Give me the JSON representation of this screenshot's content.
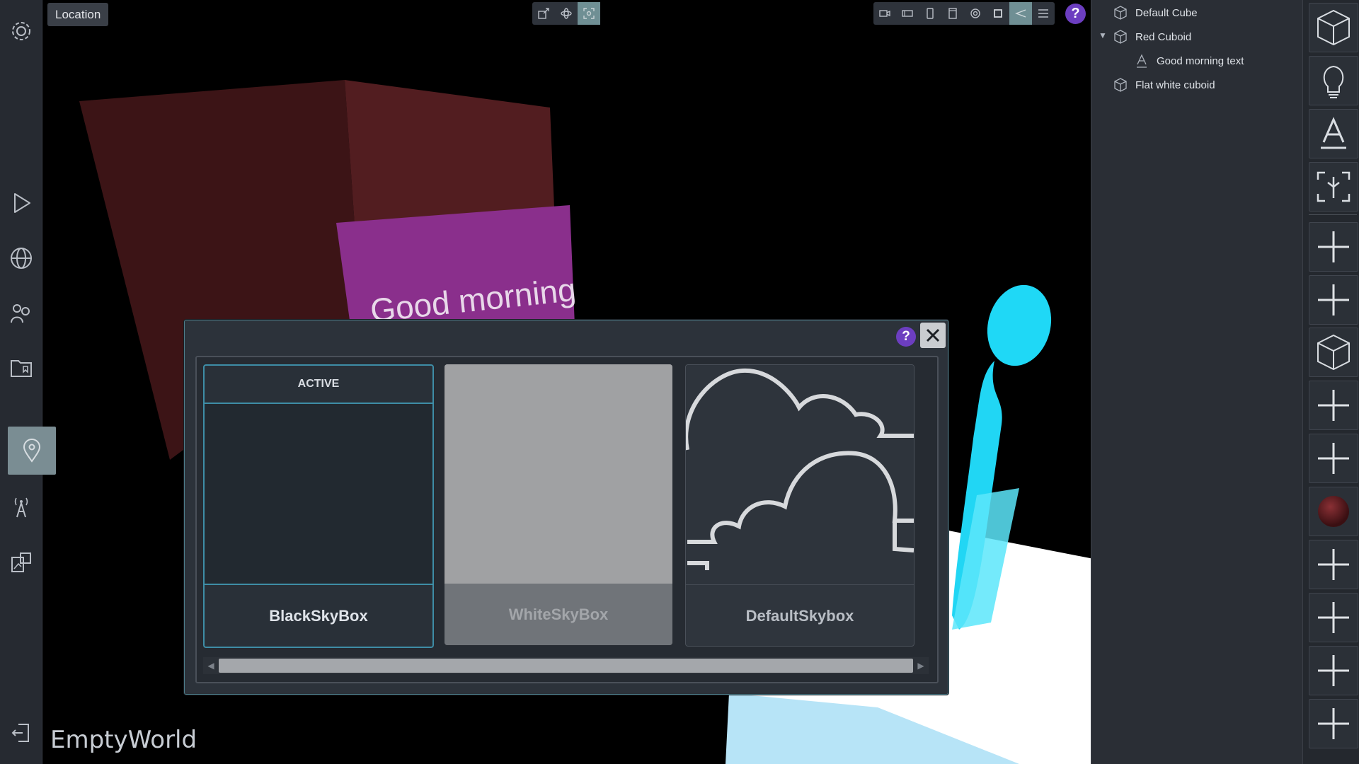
{
  "location_tag": "Location",
  "world_name": "EmptyWorld",
  "help_label": "?",
  "scene": {
    "cube_text": "Good morning"
  },
  "hierarchy": {
    "items": [
      {
        "label": "Default Cube",
        "icon": "cube-icon"
      },
      {
        "label": "Red Cuboid",
        "icon": "cube-icon",
        "expanded": true
      },
      {
        "label": "Good morning text",
        "icon": "text-icon"
      },
      {
        "label": "Flat white cuboid",
        "icon": "cube-icon"
      }
    ]
  },
  "skybox_dialog": {
    "active_badge": "ACTIVE",
    "cards": [
      {
        "name": "BlackSkyBox",
        "active": true
      },
      {
        "name": "WhiteSkyBox",
        "active": false
      },
      {
        "name": "DefaultSkybox",
        "active": false
      }
    ]
  },
  "colors": {
    "accent_teal": "#3e8da6",
    "help_purple": "#6c3ec0",
    "cuboid_red": "#5a1c1f",
    "text_panel_magenta": "#8a2f8c",
    "avatar_cyan": "#17d7f5"
  }
}
